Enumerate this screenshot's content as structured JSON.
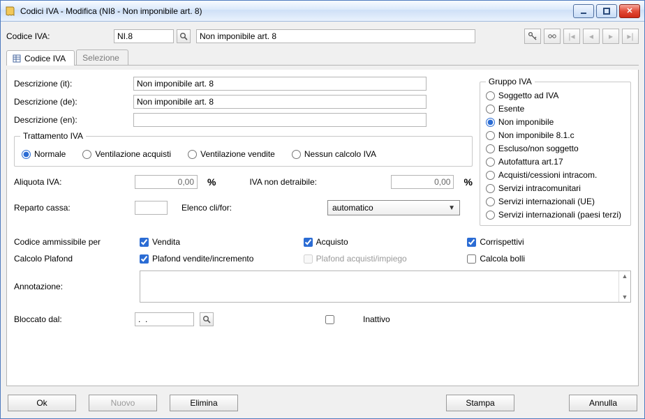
{
  "window": {
    "title": "Codici IVA - Modifica (NI8 - Non imponibile art. 8)"
  },
  "top": {
    "codice_label": "Codice IVA:",
    "codice_value": "NI.8",
    "desc_value": "Non imponibile art. 8"
  },
  "tabs": {
    "codice": "Codice IVA",
    "selezione": "Selezione"
  },
  "desc": {
    "it_label": "Descrizione (it):",
    "it_value": "Non imponibile art. 8",
    "de_label": "Descrizione (de):",
    "de_value": "Non imponibile art. 8",
    "en_label": "Descrizione (en):",
    "en_value": ""
  },
  "trattamento": {
    "legend": "Trattamento IVA",
    "normale": "Normale",
    "vent_acq": "Ventilazione acquisti",
    "vent_vend": "Ventilazione vendite",
    "no_calc": "Nessun calcolo IVA"
  },
  "aliquota": {
    "label": "Aliquota IVA:",
    "value": "0,00",
    "nondetr_label": "IVA non detraibile:",
    "nondetr_value": "0,00",
    "percent": "%"
  },
  "reparto": {
    "label": "Reparto cassa:",
    "value": "",
    "elenco_label": "Elenco cli/for:",
    "elenco_value": "automatico"
  },
  "gruppo": {
    "legend": "Gruppo IVA",
    "items": [
      "Soggetto ad IVA",
      "Esente",
      "Non imponibile",
      "Non imponibile 8.1.c",
      "Escluso/non soggetto",
      "Autofattura art.17",
      "Acquisti/cessioni intracom.",
      "Servizi intracomunitari",
      "Servizi internazionali (UE)",
      "Servizi internazionali (paesi terzi)"
    ],
    "selected_index": 2
  },
  "amm": {
    "label": "Codice ammissibile per",
    "vendita": "Vendita",
    "acquisto": "Acquisto",
    "corrispettivi": "Corrispettivi"
  },
  "plafond": {
    "label": "Calcolo Plafond",
    "vend": "Plafond vendite/incremento",
    "acq": "Plafond acquisti/impiego",
    "bolli": "Calcola bolli"
  },
  "annot": {
    "label": "Annotazione:",
    "value": ""
  },
  "bloccato": {
    "label": "Bloccato dal:",
    "value": ".  .",
    "inattivo": "Inattivo"
  },
  "buttons": {
    "ok": "Ok",
    "nuovo": "Nuovo",
    "elimina": "Elimina",
    "stampa": "Stampa",
    "annulla": "Annulla"
  }
}
